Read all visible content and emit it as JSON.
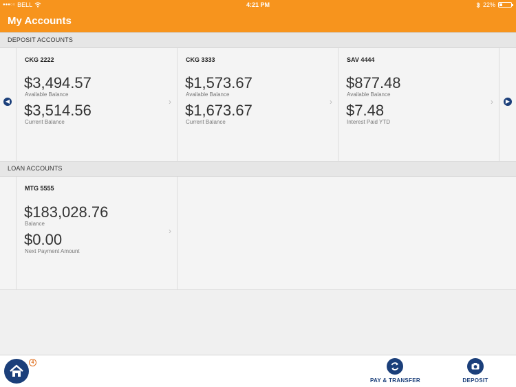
{
  "status_bar": {
    "carrier": "BELL",
    "time": "4:21 PM",
    "battery": "22%",
    "battery_level": 0.22
  },
  "header": {
    "title": "My Accounts"
  },
  "deposit_section": {
    "label": "DEPOSIT ACCOUNTS",
    "cards": [
      {
        "name": "CKG 2222",
        "amount1": "$3,494.57",
        "label1": "Available Balance",
        "amount2": "$3,514.56",
        "label2": "Current Balance"
      },
      {
        "name": "CKG 3333",
        "amount1": "$1,573.67",
        "label1": "Available Balance",
        "amount2": "$1,673.67",
        "label2": "Current Balance"
      },
      {
        "name": "SAV 4444",
        "amount1": "$877.48",
        "label1": "Available Balance",
        "amount2": "$7.48",
        "label2": "Interest Paid YTD"
      }
    ]
  },
  "loan_section": {
    "label": "LOAN  ACCOUNTS",
    "cards": [
      {
        "name": "MTG 5555",
        "amount1": "$183,028.76",
        "label1": "Balance",
        "amount2": "$0.00",
        "label2": "Next Payment Amount"
      }
    ]
  },
  "bottom_bar": {
    "badge_count": "4",
    "pay_transfer_label": "PAY & TRANSFER",
    "deposit_label": "DEPOSIT"
  },
  "icons": {
    "home": "home-icon",
    "pay_transfer": "refresh-icon",
    "deposit": "camera-icon",
    "prev": "chevron-left-icon",
    "next": "chevron-right-icon"
  },
  "colors": {
    "brand_orange": "#f7941d",
    "nav_blue": "#1b3f7a",
    "badge_orange": "#e07020"
  }
}
